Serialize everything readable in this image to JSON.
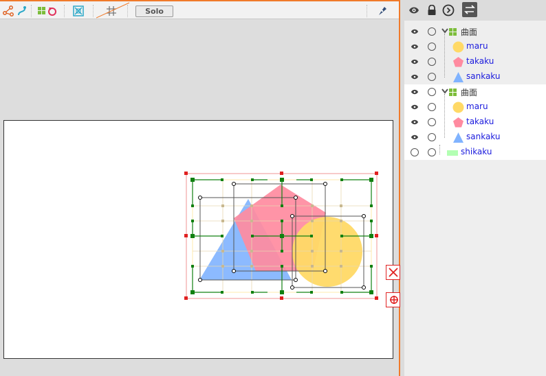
{
  "toolbar": {
    "solo_label": "Solo",
    "icons": [
      "bezier-icon",
      "curve-icon",
      "surface-icon",
      "rotate-icon",
      "fit-icon",
      "grid-icon",
      "pen-icon"
    ]
  },
  "panel": {
    "toolbar_icons": [
      "eye-icon",
      "lock-icon",
      "play-circle-icon",
      "swap-icon"
    ],
    "layers": [
      {
        "name": "曲面",
        "kind": "group",
        "visible": true
      },
      {
        "name": "maru",
        "kind": "circle",
        "color": "#ffd966",
        "visible": true
      },
      {
        "name": "takaku",
        "kind": "polygon",
        "color": "#ff8ba0",
        "visible": true
      },
      {
        "name": "sankaku",
        "kind": "triangle",
        "color": "#80b3ff",
        "visible": true
      },
      {
        "name": "曲面",
        "kind": "group",
        "visible": true
      },
      {
        "name": "maru",
        "kind": "circle",
        "color": "#ffd966",
        "visible": true
      },
      {
        "name": "takaku",
        "kind": "polygon",
        "color": "#ff8ba0",
        "visible": true
      },
      {
        "name": "sankaku",
        "kind": "triangle",
        "color": "#80b3ff",
        "visible": true
      },
      {
        "name": "shikaku",
        "kind": "rect",
        "color": "#b3ffb3",
        "visible": false
      }
    ]
  },
  "colors": {
    "accent": "#f07a2a",
    "handle_red": "#e02020",
    "handle_green": "#108010",
    "circle": "#ffd966",
    "polygon": "#ff8ba0",
    "triangle": "#80b3ff"
  }
}
